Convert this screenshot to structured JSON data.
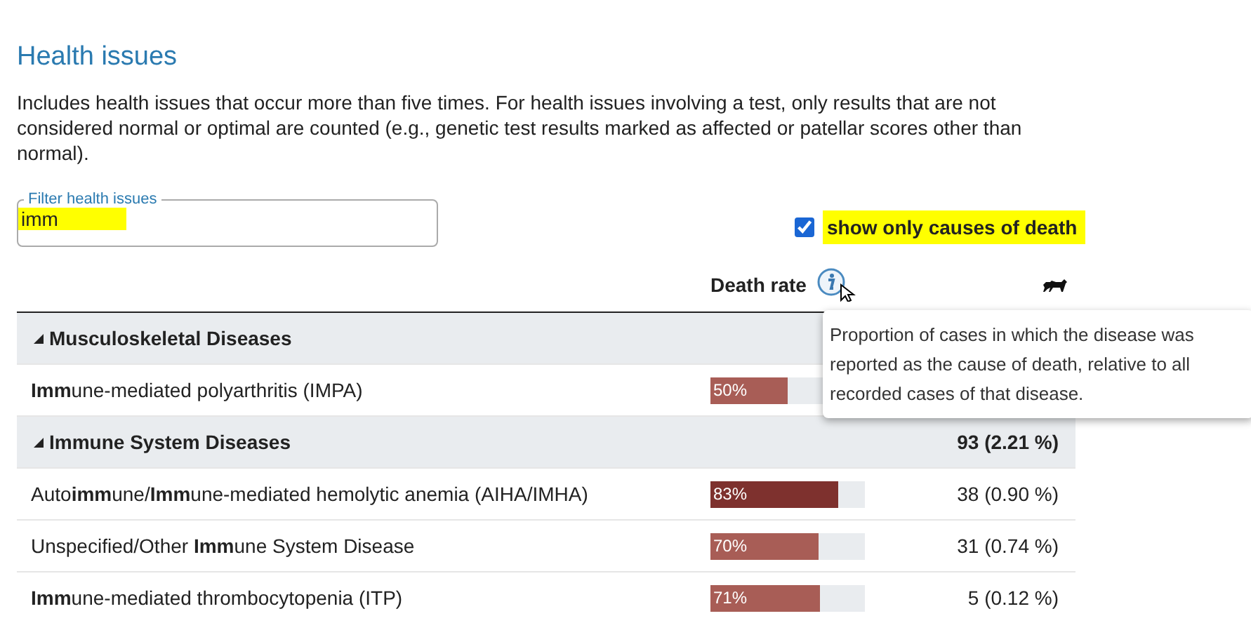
{
  "title": "Health issues",
  "description": "Includes health issues that occur more than five times. For health issues involving a test, only results that are not considered normal or optimal are counted (e.g., genetic test results marked as affected or patellar scores other than normal).",
  "filter": {
    "label": "Filter health issues",
    "value": "imm",
    "highlighted": true
  },
  "causes_of_death": {
    "label": "show only causes of death",
    "checked": true,
    "highlighted": true
  },
  "columns": {
    "death_rate": "Death rate"
  },
  "tooltip": "Proportion of cases in which the disease was reported as the cause of death, relative to all recorded cases of that disease.",
  "groups": [
    {
      "name": "Musculoskeletal Diseases",
      "expanded": true,
      "rows": [
        {
          "name": "**Imm**une-mediated polyarthritis (IMPA)",
          "rate": "50%",
          "level": 0.5,
          "color": "#a85d56"
        }
      ]
    },
    {
      "name": "Immune System Diseases",
      "expanded": true,
      "count": "93 (2.21 %)",
      "rows": [
        {
          "name": "Auto**imm**une/**Imm**une-mediated hemolytic anemia (AIHA/IMHA)",
          "rate": "83%",
          "level": 0.83,
          "color": "#7e312e",
          "count": "38 (0.90 %)"
        },
        {
          "name": "Unspecified/Other **Imm**une System Disease",
          "rate": "70%",
          "level": 0.7,
          "color": "#a85d56",
          "count": "31 (0.74 %)"
        },
        {
          "name": "**Imm**une-mediated thrombocytopenia (ITP)",
          "rate": "71%",
          "level": 0.71,
          "color": "#a85d56",
          "count": "5 (0.12 %)"
        }
      ]
    }
  ]
}
